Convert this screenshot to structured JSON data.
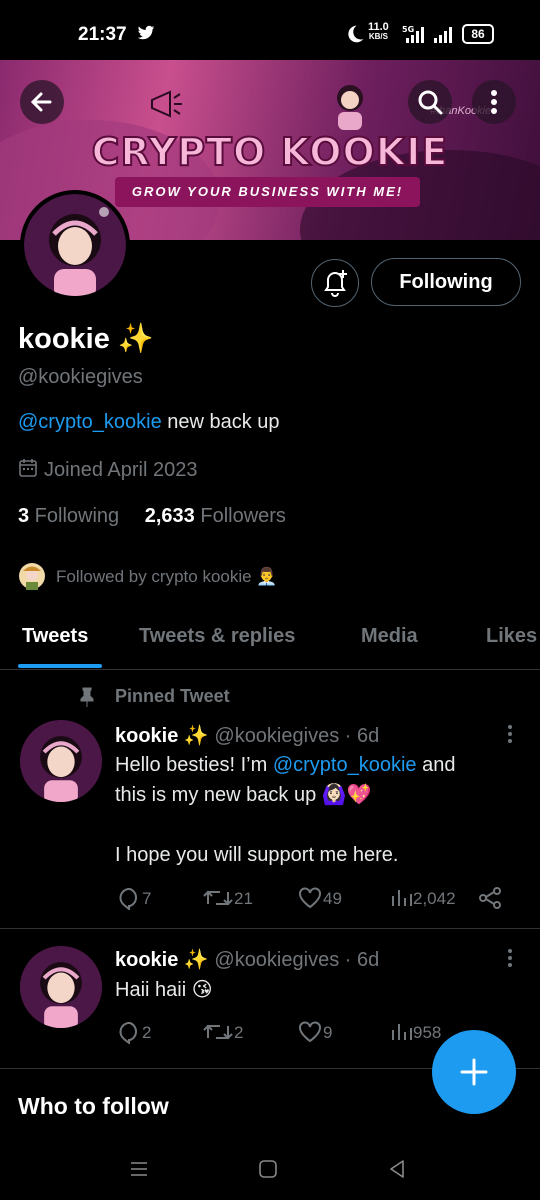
{
  "status_bar": {
    "time": "21:37",
    "speed_value": "11.0",
    "speed_unit": "KB/S",
    "network": "5G",
    "battery": "86"
  },
  "banner": {
    "title": "CRYPTO KOOKIE",
    "subtitle": "GROW YOUR BUSINESS WITH ME!",
    "handle_text": "#thanKookie"
  },
  "profile": {
    "name": "kookie ✨",
    "handle": "@kookiegives",
    "bio_mention": "@crypto_kookie",
    "bio_text": " new back up",
    "joined": "Joined April 2023",
    "following_count": "3",
    "following_label": " Following",
    "followers_count": "2,633",
    "followers_label": " Followers",
    "followed_by": "Followed by crypto kookie 👨‍💼",
    "follow_button": "Following"
  },
  "tabs": [
    "Tweets",
    "Tweets & replies",
    "Media",
    "Likes"
  ],
  "tweets": [
    {
      "pinned_label": "Pinned Tweet",
      "name": "kookie ✨",
      "meta": " @kookiegives · 6d",
      "line1_pre": "Hello besties! I’m ",
      "line1_mention": "@crypto_kookie",
      "line1_post": " and",
      "line2": "this is my new back up 🙆🏻‍♀️💖",
      "line3": "I hope you will support me here.",
      "replies": "7",
      "retweets": "21",
      "likes": "49",
      "views": "2,042"
    },
    {
      "name": "kookie ✨",
      "meta": " @kookiegives · 6d",
      "line1": "Haii haii 😘",
      "replies": "2",
      "retweets": "2",
      "likes": "9",
      "views": "958"
    }
  ],
  "who_to_follow": "Who to follow",
  "colors": {
    "accent": "#1d9bf0",
    "muted": "#71767b",
    "bg": "#000000"
  }
}
